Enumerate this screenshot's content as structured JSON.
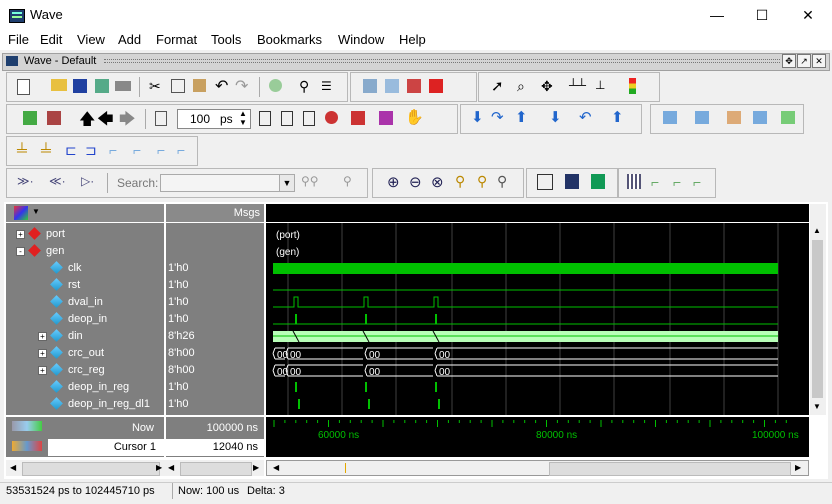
{
  "window": {
    "title": "Wave",
    "minimize": "—",
    "maximize": "☐",
    "close": "✕"
  },
  "menu": [
    "File",
    "Edit",
    "View",
    "Add",
    "Format",
    "Tools",
    "Bookmarks",
    "Window",
    "Help"
  ],
  "inner_window": {
    "title": "Wave - Default"
  },
  "toolbar": {
    "time_value": "100",
    "time_unit": "ps",
    "search_label": "Search:",
    "search_value": ""
  },
  "columns": {
    "msgs": "Msgs"
  },
  "signals": [
    {
      "name": "port",
      "value": "",
      "expander": "+",
      "kind": "group"
    },
    {
      "name": "gen",
      "value": "",
      "expander": "-",
      "kind": "group"
    },
    {
      "name": "clk",
      "value": "1'h0",
      "expander": "",
      "kind": "signal"
    },
    {
      "name": "rst",
      "value": "1'h0",
      "expander": "",
      "kind": "signal"
    },
    {
      "name": "dval_in",
      "value": "1'h0",
      "expander": "",
      "kind": "signal"
    },
    {
      "name": "deop_in",
      "value": "1'h0",
      "expander": "",
      "kind": "signal"
    },
    {
      "name": "din",
      "value": "8'h26",
      "expander": "+",
      "kind": "bus"
    },
    {
      "name": "crc_out",
      "value": "8'h00",
      "expander": "+",
      "kind": "bus"
    },
    {
      "name": "crc_reg",
      "value": "8'h00",
      "expander": "+",
      "kind": "bus"
    },
    {
      "name": "deop_in_reg",
      "value": "1'h0",
      "expander": "",
      "kind": "signal"
    },
    {
      "name": "deop_in_reg_dl1",
      "value": "1'h0",
      "expander": "",
      "kind": "signal"
    }
  ],
  "wave_labels": {
    "port": "(port)",
    "gen": "(gen)"
  },
  "bus_values": {
    "crc_out": [
      "00",
      "00",
      "00",
      "00"
    ],
    "crc_reg": [
      "00",
      "00",
      "00",
      "00"
    ]
  },
  "cursor_pane": {
    "now_label": "Now",
    "now_value": "100000 ns",
    "cursor_label": "Cursor 1",
    "cursor_value": "12040 ns",
    "time_ticks": [
      "60000 ns",
      "80000 ns",
      "100000 ns"
    ]
  },
  "status": {
    "range": "53531524 ps to 102445710 ps",
    "now": "Now: 100 us",
    "delta": "Delta: 3"
  },
  "colors": {
    "wave_bg": "#000000",
    "wave_green": "#00c000",
    "bus_fill": "#b8ffb8",
    "list_bg": "#7f7f7f",
    "grid": "#404040"
  }
}
